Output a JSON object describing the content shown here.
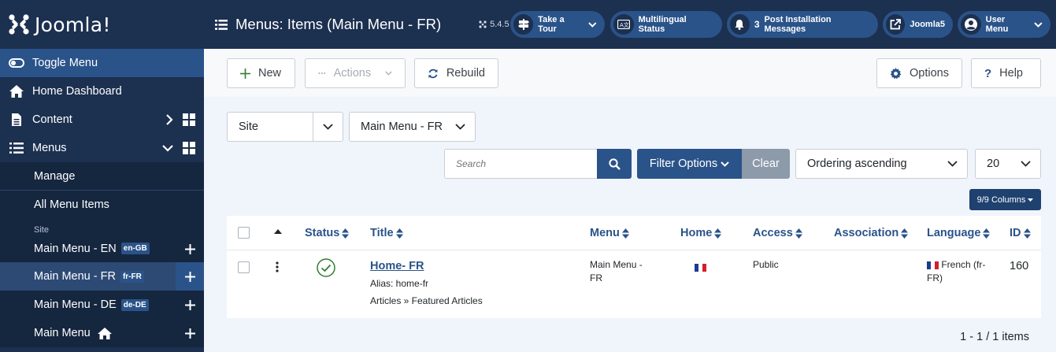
{
  "brand": {
    "name": "Joomla!"
  },
  "sidebar": {
    "toggle": "Toggle Menu",
    "home": "Home Dashboard",
    "content": "Content",
    "menus": "Menus",
    "sub": {
      "manage": "Manage",
      "all_items": "All Menu Items",
      "site_label": "Site",
      "menus": [
        {
          "label": "Main Menu - EN",
          "badge": "en-GB"
        },
        {
          "label": "Main Menu - FR",
          "badge": "fr-FR"
        },
        {
          "label": "Main Menu - DE",
          "badge": "de-DE"
        },
        {
          "label": "Main Menu",
          "badge": ""
        }
      ]
    }
  },
  "header": {
    "title": "Menus: Items (Main Menu - FR)",
    "version": "5.4.5",
    "buttons": {
      "tour": "Take a Tour",
      "multilingual": "Multilingual Status",
      "post_install_count": "3",
      "post_install": "Post Installation Messages",
      "site": "Joomla5",
      "user": "User Menu"
    }
  },
  "toolbar": {
    "new": "New",
    "actions": "Actions",
    "rebuild": "Rebuild",
    "options": "Options",
    "help": "Help"
  },
  "filters": {
    "client": "Site",
    "menu": "Main Menu - FR",
    "search_placeholder": "Search",
    "filter_options": "Filter Options",
    "clear": "Clear",
    "ordering": "Ordering ascending",
    "limit": "20",
    "columns": "9/9 Columns"
  },
  "table": {
    "headers": {
      "status": "Status",
      "title": "Title",
      "menu": "Menu",
      "home": "Home",
      "access": "Access",
      "association": "Association",
      "language": "Language",
      "id": "ID"
    },
    "rows": [
      {
        "title": "Home- FR",
        "alias": "Alias: home-fr",
        "type": "Articles » Featured Articles",
        "menu_line1": "Main Menu -",
        "menu_line2": "FR",
        "access": "Public",
        "language_line1": "French (fr-",
        "language_line2": "FR)",
        "id": "160"
      }
    ]
  },
  "pagination": {
    "info": "1 - 1 / 1 items"
  },
  "colors": {
    "navy": "#1c3050",
    "accent": "#2a5389",
    "success": "#2f7d32"
  }
}
